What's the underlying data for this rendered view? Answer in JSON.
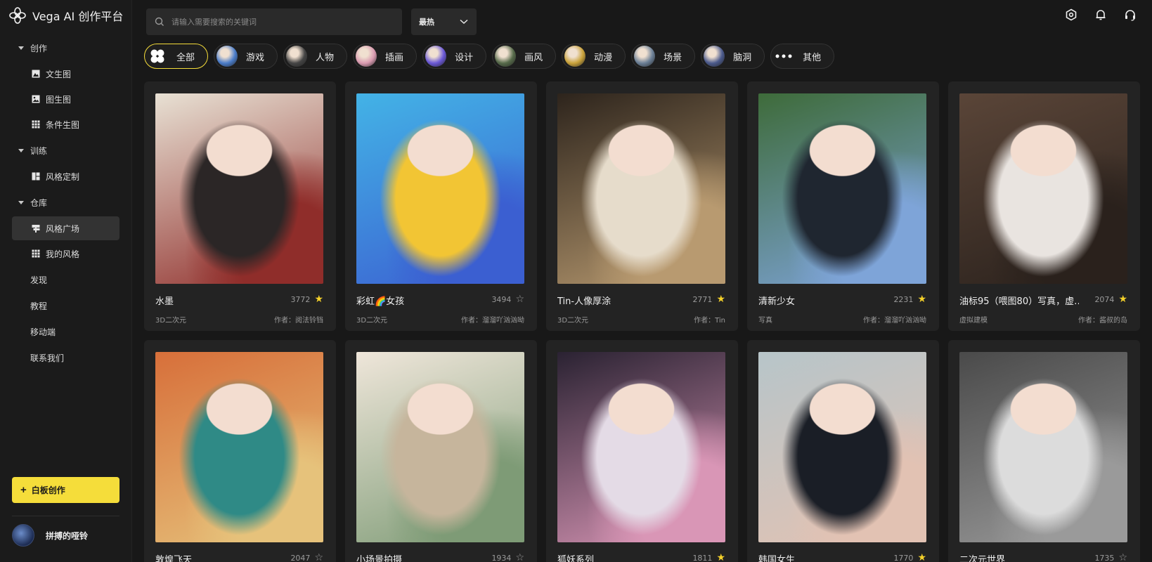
{
  "app": {
    "title": "Vega AI 创作平台"
  },
  "sidebar": {
    "groups": [
      {
        "label": "创作",
        "items": [
          {
            "label": "文生图",
            "icon": "image-icon"
          },
          {
            "label": "图生图",
            "icon": "picture-icon"
          },
          {
            "label": "条件生图",
            "icon": "grid-icon"
          }
        ]
      },
      {
        "label": "训练",
        "items": [
          {
            "label": "风格定制",
            "icon": "layout-icon"
          }
        ]
      },
      {
        "label": "仓库",
        "items": [
          {
            "label": "风格广场",
            "icon": "signpost-icon",
            "active": true
          },
          {
            "label": "我的风格",
            "icon": "apps-icon"
          }
        ]
      }
    ],
    "links": [
      "发现",
      "教程",
      "移动端",
      "联系我们"
    ],
    "whiteboard": {
      "plus": "+",
      "label": "白板创作"
    },
    "user": {
      "name": "拼搏的哑铃"
    }
  },
  "search": {
    "placeholder": "请输入需要搜索的关键词"
  },
  "sort": {
    "selected": "最热"
  },
  "categories": [
    {
      "label": "全部",
      "active": true,
      "color": "#f5dd3a"
    },
    {
      "label": "游戏",
      "color": "#4a7cc9"
    },
    {
      "label": "人物",
      "color": "#444444"
    },
    {
      "label": "插画",
      "color": "#d99ab0"
    },
    {
      "label": "设计",
      "color": "#6a58d6"
    },
    {
      "label": "画风",
      "color": "#566a4a"
    },
    {
      "label": "动漫",
      "color": "#c9a23a"
    },
    {
      "label": "场景",
      "color": "#6b7f96"
    },
    {
      "label": "脑洞",
      "color": "#4b5a8c"
    },
    {
      "label": "其他",
      "more": true,
      "color": "#333333"
    }
  ],
  "cards": [
    {
      "title": "水墨",
      "likes": "3772",
      "starred": true,
      "tag": "3D二次元",
      "author": "作者：阅法铃铛",
      "colors": [
        "#e8e1d4",
        "#2b2626",
        "#8f2d2a"
      ]
    },
    {
      "title": "彩虹🌈女孩",
      "likes": "3494",
      "starred": false,
      "tag": "3D二次元",
      "author": "作者：溜溜吖汹汹呦",
      "colors": [
        "#43b3e6",
        "#f2c534",
        "#3b5fd1"
      ]
    },
    {
      "title": "Tin-人像厚涂",
      "likes": "2771",
      "starred": true,
      "tag": "3D二次元",
      "author": "作者：Tin",
      "colors": [
        "#2d241c",
        "#e6dccb",
        "#b89a70"
      ]
    },
    {
      "title": "清新少女",
      "likes": "2231",
      "starred": true,
      "tag": "写真",
      "author": "作者：溜溜吖汹汹呦",
      "colors": [
        "#3e6b3a",
        "#1f2630",
        "#7ea4d8"
      ]
    },
    {
      "title": "油标95（喂图80）写真，虚…",
      "likes": "2074",
      "starred": true,
      "tag": "虚拟建模",
      "author": "作者：酱叔的岛",
      "colors": [
        "#5a4538",
        "#e9e4e0",
        "#2a211c"
      ]
    },
    {
      "title": "敦煌飞天",
      "likes": "2047",
      "starred": false,
      "tag": "",
      "author": "",
      "colors": [
        "#d76f3a",
        "#2f8a86",
        "#e6c27b"
      ]
    },
    {
      "title": "小场景拍摄",
      "likes": "1934",
      "starred": false,
      "tag": "",
      "author": "",
      "colors": [
        "#efe6da",
        "#c6b59c",
        "#7e9b76"
      ]
    },
    {
      "title": "狐妖系列",
      "likes": "1811",
      "starred": true,
      "tag": "",
      "author": "",
      "colors": [
        "#2a2232",
        "#e4dbe6",
        "#d996b6"
      ]
    },
    {
      "title": "韩国女生",
      "likes": "1770",
      "starred": true,
      "tag": "",
      "author": "",
      "colors": [
        "#b7c5c9",
        "#1a1e26",
        "#e2c2b3"
      ]
    },
    {
      "title": "二次元世界",
      "likes": "1735",
      "starred": false,
      "tag": "",
      "author": "",
      "colors": [
        "#4a4a4a",
        "#dcdcdc",
        "#9a9a9a"
      ]
    }
  ]
}
